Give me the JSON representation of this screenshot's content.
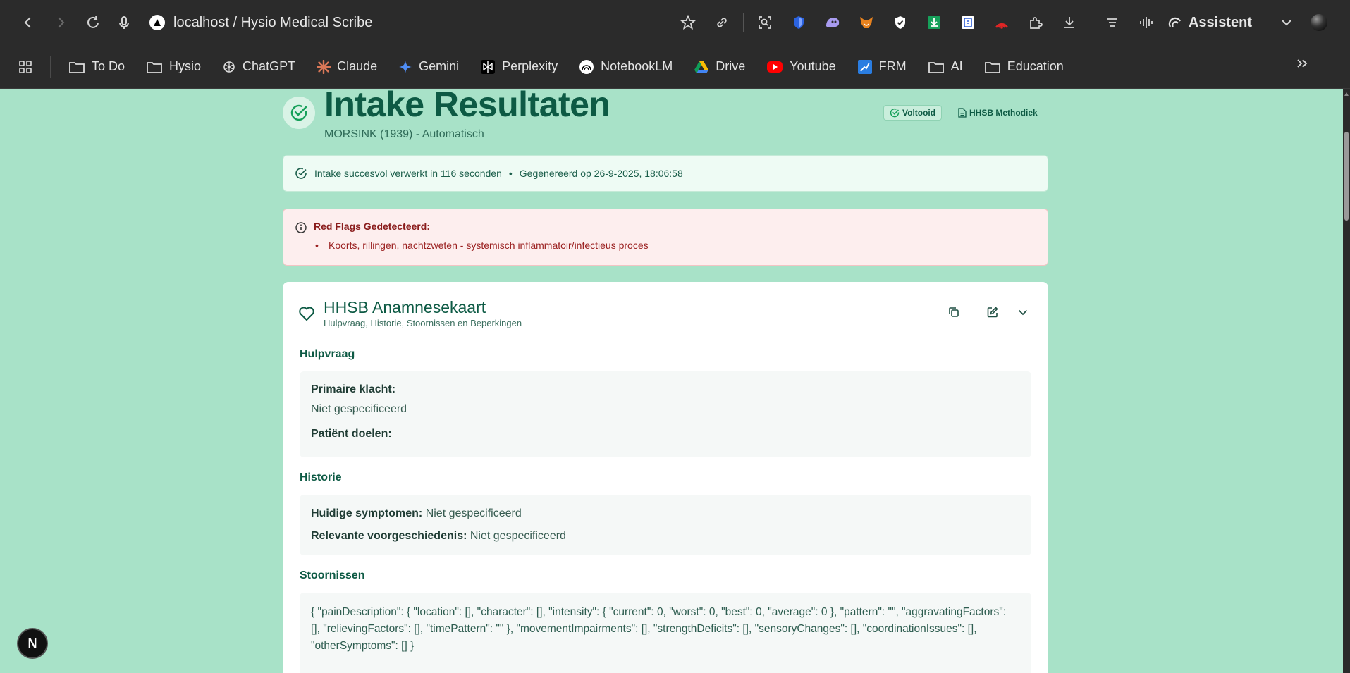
{
  "browser": {
    "url_text": "localhost / Hysio Medical Scribe",
    "assistant_label": "Assistent",
    "bookmarks": [
      {
        "label": "To Do",
        "icon": "folder-icon"
      },
      {
        "label": "Hysio",
        "icon": "folder-icon"
      },
      {
        "label": "ChatGPT",
        "icon": "chatgpt-icon"
      },
      {
        "label": "Claude",
        "icon": "claude-icon"
      },
      {
        "label": "Gemini",
        "icon": "gemini-icon"
      },
      {
        "label": "Perplexity",
        "icon": "perplexity-icon"
      },
      {
        "label": "NotebookLM",
        "icon": "notebooklm-icon"
      },
      {
        "label": "Drive",
        "icon": "drive-icon"
      },
      {
        "label": "Youtube",
        "icon": "youtube-icon"
      },
      {
        "label": "FRM",
        "icon": "frm-icon"
      },
      {
        "label": "AI",
        "icon": "folder-icon"
      },
      {
        "label": "Education",
        "icon": "folder-icon"
      }
    ]
  },
  "header": {
    "title": "Intake Resultaten",
    "subtitle": "MORSINK (1939) - Automatisch",
    "status_pill": "Voltooid",
    "method_pill": "HHSB Methodiek"
  },
  "success": {
    "message": "Intake succesvol verwerkt in 116 seconden",
    "separator": "•",
    "generated": "Gegenereerd op 26-9-2025, 18:06:58"
  },
  "red_flags": {
    "title": "Red Flags Gedetecteerd:",
    "items": [
      "Koorts, rillingen, nachtzweten - systemisch inflammatoir/infectieus proces"
    ]
  },
  "card": {
    "title": "HHSB Anamnesekaart",
    "subtitle": "Hulpvraag, Historie, Stoornissen en Beperkingen",
    "sections": {
      "hulpvraag": {
        "title": "Hulpvraag",
        "primary_label": "Primaire klacht:",
        "primary_value": "Niet gespecificeerd",
        "goals_label": "Patiënt doelen:"
      },
      "historie": {
        "title": "Historie",
        "symptoms_label": "Huidige symptomen:",
        "symptoms_value": "Niet gespecificeerd",
        "history_label": "Relevante voorgeschiedenis:",
        "history_value": "Niet gespecificeerd"
      },
      "stoornissen": {
        "title": "Stoornissen",
        "raw": "{ \"painDescription\": { \"location\": [], \"character\": [], \"intensity\": { \"current\": 0, \"worst\": 0, \"best\": 0, \"average\": 0 }, \"pattern\": \"\", \"aggravatingFactors\": [], \"relievingFactors\": [], \"timePattern\": \"\" }, \"movementImpairments\": [], \"strengthDeficits\": [], \"sensoryChanges\": [], \"coordinationIssues\": [], \"otherSymptoms\": [] }"
      }
    }
  },
  "dev_badge": "N",
  "colors": {
    "page_background": "#a8e2c8",
    "primary_green": "#0d5a44",
    "flag_red": "#9a1f1f",
    "chrome_dark": "#2b2b2b"
  }
}
